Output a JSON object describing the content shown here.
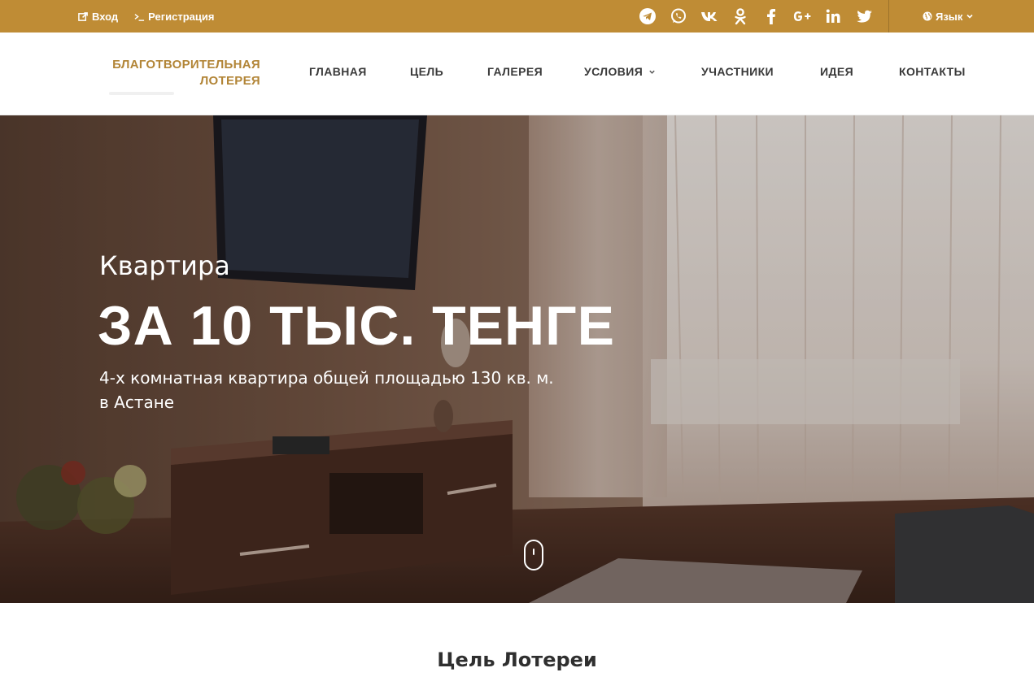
{
  "topbar": {
    "login_label": "Вход",
    "register_label": "Регистрация",
    "language_label": "Язык",
    "social": [
      "telegram-icon",
      "whatsapp-icon",
      "vk-icon",
      "odnoklassniki-icon",
      "facebook-icon",
      "google-plus-icon",
      "linkedin-icon",
      "twitter-icon"
    ],
    "background_color": "#bf8c35"
  },
  "logo": {
    "line1": "БЛАГОТВОРИТЕЛЬНАЯ",
    "line2": "ЛОТЕРЕЯ",
    "color": "#b28537"
  },
  "nav": {
    "items": [
      "ГЛАВНАЯ",
      "ЦЕЛЬ",
      "ГАЛЕРЕЯ",
      "УСЛОВИЯ",
      "УЧАСТНИКИ",
      "ИДЕЯ",
      "КОНТАКТЫ"
    ]
  },
  "hero": {
    "pretitle": "Квартира",
    "title": "ЗА 10 ТЫС. ТЕНГЕ",
    "subtitle": "4-х комнатная квартира общей площадью 130 кв. м. в Астане"
  },
  "section": {
    "title": "Цель Лотереи"
  }
}
